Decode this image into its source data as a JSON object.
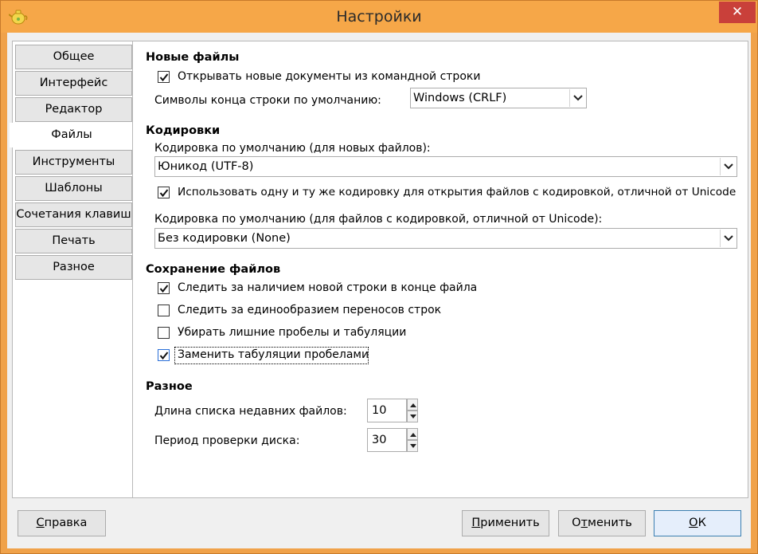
{
  "window": {
    "title": "Настройки",
    "close_symbol": "✕",
    "app_icon": "teapot-icon"
  },
  "sidebar": {
    "items": [
      {
        "label": "Общее"
      },
      {
        "label": "Интерфейс"
      },
      {
        "label": "Редактор"
      },
      {
        "label": "Файлы",
        "active": true
      },
      {
        "label": "Инструменты"
      },
      {
        "label": "Шаблоны"
      },
      {
        "label": "Сочетания клавиш"
      },
      {
        "label": "Печать"
      },
      {
        "label": "Разное"
      }
    ]
  },
  "new_files": {
    "heading": "Новые файлы",
    "open_from_cmdline": {
      "label": "Открывать новые документы из командной строки",
      "checked": true
    },
    "eol_label": "Символы конца строки по умолчанию:",
    "eol_value": "Windows (CRLF)"
  },
  "encodings": {
    "heading": "Кодировки",
    "default_label": "Кодировка по умолчанию (для новых файлов):",
    "default_value": "Юникод (UTF-8)",
    "same_encoding": {
      "label": "Использовать одну и ту же кодировку для открытия файлов с кодировкой, отличной от Unicode",
      "checked": true
    },
    "non_unicode_label": "Кодировка по умолчанию (для файлов с кодировкой, отличной от Unicode):",
    "non_unicode_value": "Без кодировки (None)"
  },
  "saving": {
    "heading": "Сохранение файлов",
    "options": [
      {
        "label": "Следить за наличием новой строки в конце файла",
        "checked": true
      },
      {
        "label": "Следить за единообразием переносов строк",
        "checked": false
      },
      {
        "label": "Убирать лишние пробелы и табуляции",
        "checked": false
      },
      {
        "label": "Заменить табуляции пробелами",
        "checked": true,
        "focused": true
      }
    ]
  },
  "misc": {
    "heading": "Разное",
    "recent_label": "Длина списка недавних файлов:",
    "recent_value": "10",
    "disk_label": "Период проверки диска:",
    "disk_value": "30"
  },
  "buttons": {
    "help": {
      "mnemonic": "С",
      "rest": "правка"
    },
    "apply": {
      "mnemonic": "П",
      "rest": "рименить"
    },
    "cancel": {
      "pre": "О",
      "mnemonic": "т",
      "rest": "менить"
    },
    "ok": {
      "mnemonic": "О",
      "rest": "К"
    }
  },
  "colors": {
    "titlebar": "#f6a748",
    "close": "#c9403a",
    "accent": "#3c7fb1"
  }
}
